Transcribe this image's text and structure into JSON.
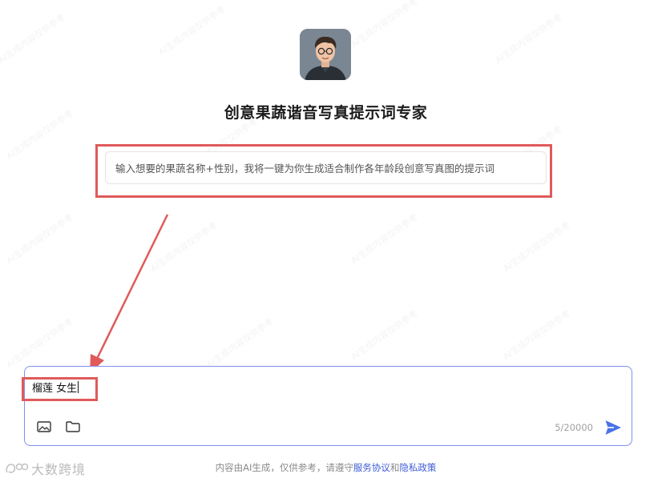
{
  "bot": {
    "title": "创意果蔬谐音写真提示词专家",
    "intro": "输入想要的果蔬名称+性别，我将一键为你生成适合制作各年龄段创意写真图的提示词"
  },
  "composer": {
    "input_value": "榴莲 女生",
    "char_count": "5/20000"
  },
  "footer": {
    "prefix": "内容由AI生成，仅供参考，请遵守",
    "terms": "服务协议",
    "and": "和",
    "privacy": "隐私政策"
  },
  "brand": {
    "label": "大数跨境"
  },
  "watermark_text": "AI生成内容仅供参考",
  "colors": {
    "highlight": "#e05a5a",
    "accent": "#3d5bd6",
    "composer_border": "#7e8ff0",
    "send": "#4a72e8"
  },
  "icons": {
    "image": "image-icon",
    "folder": "folder-icon",
    "send": "send-icon",
    "brand": "brand-logo-icon"
  }
}
